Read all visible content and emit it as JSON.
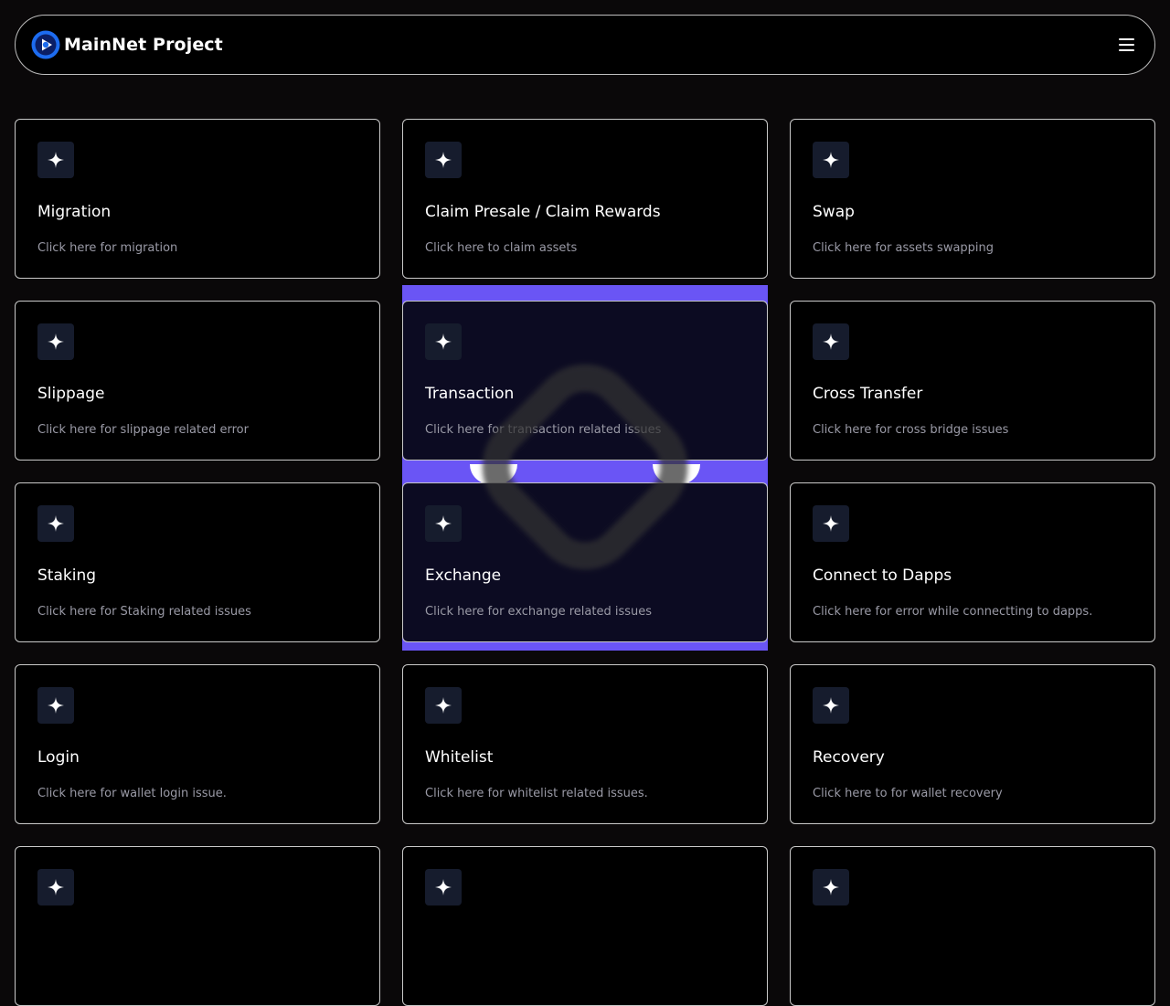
{
  "header": {
    "brand": "MainNet Project",
    "logo_icon": "play-circle-logo-icon",
    "menu_icon": "hamburger-menu-icon"
  },
  "colors": {
    "background": "#0a0809",
    "card_border": "#c9c9c9",
    "icon_tile": "#161c2d",
    "highlight": "#6a55f5",
    "description_text": "#9a9aa6"
  },
  "cards": [
    {
      "title": "Migration",
      "desc": "Click here for migration",
      "icon": "sparkle-icon"
    },
    {
      "title": "Claim Presale / Claim Rewards",
      "desc": "Click here to claim assets",
      "icon": "sparkle-icon"
    },
    {
      "title": "Swap",
      "desc": "Click here for assets swapping",
      "icon": "sparkle-icon"
    },
    {
      "title": "Slippage",
      "desc": "Click here for slippage related error",
      "icon": "sparkle-icon"
    },
    {
      "title": "Transaction",
      "desc": "Click here for transaction related issues",
      "icon": "sparkle-icon"
    },
    {
      "title": "Cross Transfer",
      "desc": "Click here for cross bridge issues",
      "icon": "sparkle-icon"
    },
    {
      "title": "Staking",
      "desc": "Click here for Staking related issues",
      "icon": "sparkle-icon"
    },
    {
      "title": "Exchange",
      "desc": "Click here for exchange related issues",
      "icon": "sparkle-icon"
    },
    {
      "title": "Connect to Dapps",
      "desc": "Click here for error while connectting to dapps.",
      "icon": "sparkle-icon"
    },
    {
      "title": "Login",
      "desc": "Click here for wallet login issue.",
      "icon": "sparkle-icon"
    },
    {
      "title": "Whitelist",
      "desc": "Click here for whitelist related issues.",
      "icon": "sparkle-icon"
    },
    {
      "title": "Recovery",
      "desc": "Click here to for wallet recovery",
      "icon": "sparkle-icon"
    },
    {
      "title": "",
      "desc": "",
      "icon": "sparkle-icon"
    },
    {
      "title": "",
      "desc": "",
      "icon": "sparkle-icon"
    },
    {
      "title": "",
      "desc": "",
      "icon": "sparkle-icon"
    }
  ]
}
